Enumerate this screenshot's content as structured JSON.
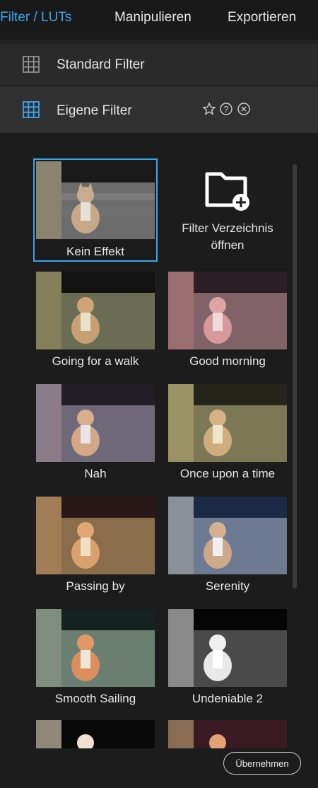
{
  "tabs": [
    {
      "label": "Filter / LUTs",
      "active": true
    },
    {
      "label": "Manipulieren"
    },
    {
      "label": "Exportieren"
    }
  ],
  "sections": {
    "standard": {
      "label": "Standard Filter",
      "icon": "grid-icon"
    },
    "custom": {
      "label": "Eigene Filter",
      "icon": "grid-icon",
      "actions": [
        "star-icon",
        "help-icon",
        "close-circle-icon"
      ]
    }
  },
  "folder": {
    "label_line1": "Filter Verzeichnis",
    "label_line2": "öffnen",
    "icon": "folder-add-icon"
  },
  "filters": [
    {
      "name": "Kein Effekt",
      "selected": true,
      "tint": "#b7b0a6"
    },
    {
      "name": "Going for a walk",
      "tint": "#9aa07a"
    },
    {
      "name": "Good morning",
      "tint": "#c78a8a"
    },
    {
      "name": "Nah",
      "tint": "#9a8aa0"
    },
    {
      "name": "Once upon a time",
      "tint": "#b4ab72"
    },
    {
      "name": "Passing by",
      "tint": "#b88c62"
    },
    {
      "name": "Serenity",
      "tint": "#7f9ab8"
    },
    {
      "name": "Smooth Sailing",
      "tint": "#90a890"
    },
    {
      "name": "Undeniable 2",
      "tint": "#c0c0c0"
    }
  ],
  "apply_label": "Übernehmen",
  "colors": {
    "accent": "#3aa6ec"
  }
}
